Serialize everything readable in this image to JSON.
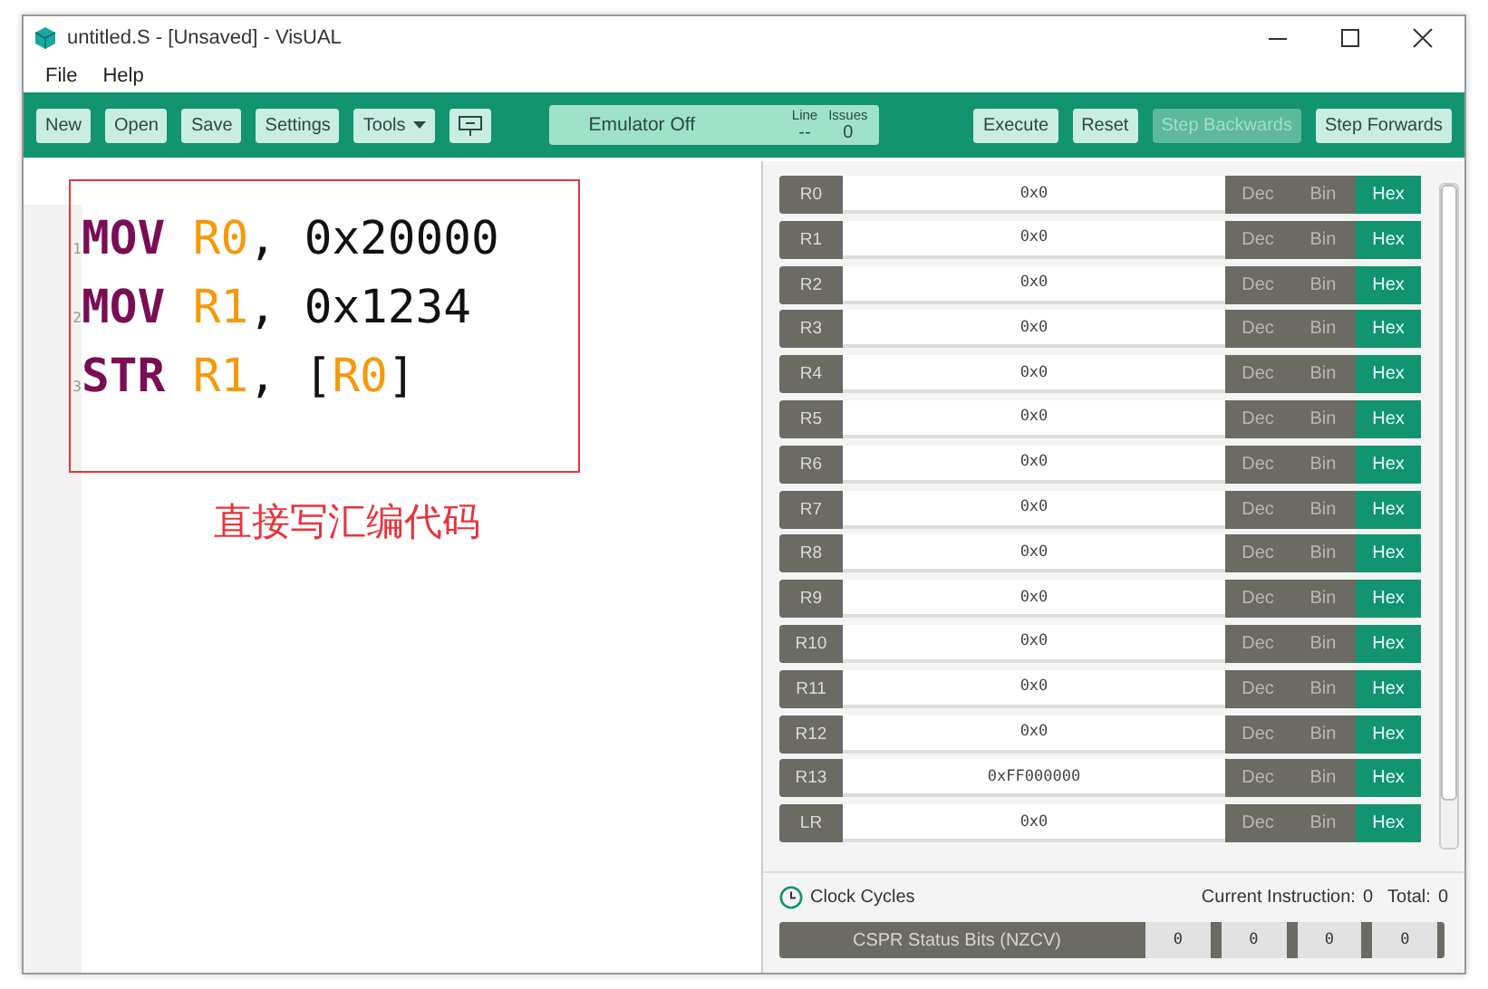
{
  "window": {
    "title": "untitled.S - [Unsaved] - VisUAL"
  },
  "menu": [
    "File",
    "Help"
  ],
  "toolbar": {
    "left": [
      {
        "label": "New",
        "kind": "text"
      },
      {
        "label": "Open",
        "kind": "text"
      },
      {
        "label": "Save",
        "kind": "text"
      },
      {
        "label": "Settings",
        "kind": "text"
      },
      {
        "label": "Tools",
        "kind": "dropdown"
      },
      {
        "kind": "icon"
      }
    ],
    "status": {
      "text": "Emulator Off",
      "line_label": "Line",
      "issues_label": "Issues",
      "line": "--",
      "issues": "0"
    },
    "right": [
      {
        "label": "Execute",
        "disabled": false
      },
      {
        "label": "Reset",
        "disabled": false
      },
      {
        "label": "Step Backwards",
        "disabled": true
      },
      {
        "label": "Step Forwards",
        "disabled": false
      }
    ]
  },
  "editor": {
    "lines": [
      {
        "number": "1",
        "tokens": [
          {
            "kind": "keyword",
            "text": "MOV "
          },
          {
            "kind": "register",
            "text": "R0"
          },
          {
            "kind": "plain",
            "text": ", 0x20000"
          }
        ]
      },
      {
        "number": "2",
        "tokens": [
          {
            "kind": "keyword",
            "text": "MOV "
          },
          {
            "kind": "register",
            "text": "R1"
          },
          {
            "kind": "plain",
            "text": ", 0x1234"
          }
        ]
      },
      {
        "number": "3",
        "tokens": [
          {
            "kind": "keyword",
            "text": "STR "
          },
          {
            "kind": "register",
            "text": "R1"
          },
          {
            "kind": "plain",
            "text": ", ["
          },
          {
            "kind": "register",
            "text": "R0"
          },
          {
            "kind": "plain",
            "text": "]"
          }
        ]
      }
    ],
    "annotation": "直接写汇编代码"
  },
  "registers": [
    {
      "name": "R0",
      "value": "0x0",
      "formats": [
        {
          "label": "Dec",
          "selected": false
        },
        {
          "label": "Bin",
          "selected": false
        },
        {
          "label": "Hex",
          "selected": true
        }
      ]
    },
    {
      "name": "R1",
      "value": "0x0",
      "formats": [
        {
          "label": "Dec",
          "selected": false
        },
        {
          "label": "Bin",
          "selected": false
        },
        {
          "label": "Hex",
          "selected": true
        }
      ]
    },
    {
      "name": "R2",
      "value": "0x0",
      "formats": [
        {
          "label": "Dec",
          "selected": false
        },
        {
          "label": "Bin",
          "selected": false
        },
        {
          "label": "Hex",
          "selected": true
        }
      ]
    },
    {
      "name": "R3",
      "value": "0x0",
      "formats": [
        {
          "label": "Dec",
          "selected": false
        },
        {
          "label": "Bin",
          "selected": false
        },
        {
          "label": "Hex",
          "selected": true
        }
      ]
    },
    {
      "name": "R4",
      "value": "0x0",
      "formats": [
        {
          "label": "Dec",
          "selected": false
        },
        {
          "label": "Bin",
          "selected": false
        },
        {
          "label": "Hex",
          "selected": true
        }
      ]
    },
    {
      "name": "R5",
      "value": "0x0",
      "formats": [
        {
          "label": "Dec",
          "selected": false
        },
        {
          "label": "Bin",
          "selected": false
        },
        {
          "label": "Hex",
          "selected": true
        }
      ]
    },
    {
      "name": "R6",
      "value": "0x0",
      "formats": [
        {
          "label": "Dec",
          "selected": false
        },
        {
          "label": "Bin",
          "selected": false
        },
        {
          "label": "Hex",
          "selected": true
        }
      ]
    },
    {
      "name": "R7",
      "value": "0x0",
      "formats": [
        {
          "label": "Dec",
          "selected": false
        },
        {
          "label": "Bin",
          "selected": false
        },
        {
          "label": "Hex",
          "selected": true
        }
      ]
    },
    {
      "name": "R8",
      "value": "0x0",
      "formats": [
        {
          "label": "Dec",
          "selected": false
        },
        {
          "label": "Bin",
          "selected": false
        },
        {
          "label": "Hex",
          "selected": true
        }
      ]
    },
    {
      "name": "R9",
      "value": "0x0",
      "formats": [
        {
          "label": "Dec",
          "selected": false
        },
        {
          "label": "Bin",
          "selected": false
        },
        {
          "label": "Hex",
          "selected": true
        }
      ]
    },
    {
      "name": "R10",
      "value": "0x0",
      "formats": [
        {
          "label": "Dec",
          "selected": false
        },
        {
          "label": "Bin",
          "selected": false
        },
        {
          "label": "Hex",
          "selected": true
        }
      ]
    },
    {
      "name": "R11",
      "value": "0x0",
      "formats": [
        {
          "label": "Dec",
          "selected": false
        },
        {
          "label": "Bin",
          "selected": false
        },
        {
          "label": "Hex",
          "selected": true
        }
      ]
    },
    {
      "name": "R12",
      "value": "0x0",
      "formats": [
        {
          "label": "Dec",
          "selected": false
        },
        {
          "label": "Bin",
          "selected": false
        },
        {
          "label": "Hex",
          "selected": true
        }
      ]
    },
    {
      "name": "R13",
      "value": "0xFF000000",
      "formats": [
        {
          "label": "Dec",
          "selected": false
        },
        {
          "label": "Bin",
          "selected": false
        },
        {
          "label": "Hex",
          "selected": true
        }
      ]
    },
    {
      "name": "LR",
      "value": "0x0",
      "formats": [
        {
          "label": "Dec",
          "selected": false
        },
        {
          "label": "Bin",
          "selected": false
        },
        {
          "label": "Hex",
          "selected": true
        }
      ]
    }
  ],
  "clock": {
    "label": "Clock Cycles",
    "current_label": "Current Instruction:",
    "current": "0",
    "total_label": "Total:",
    "total": "0"
  },
  "status_bits": {
    "label": "CSPR Status Bits (NZCV)",
    "values": [
      "0",
      "0",
      "0",
      "0"
    ]
  }
}
